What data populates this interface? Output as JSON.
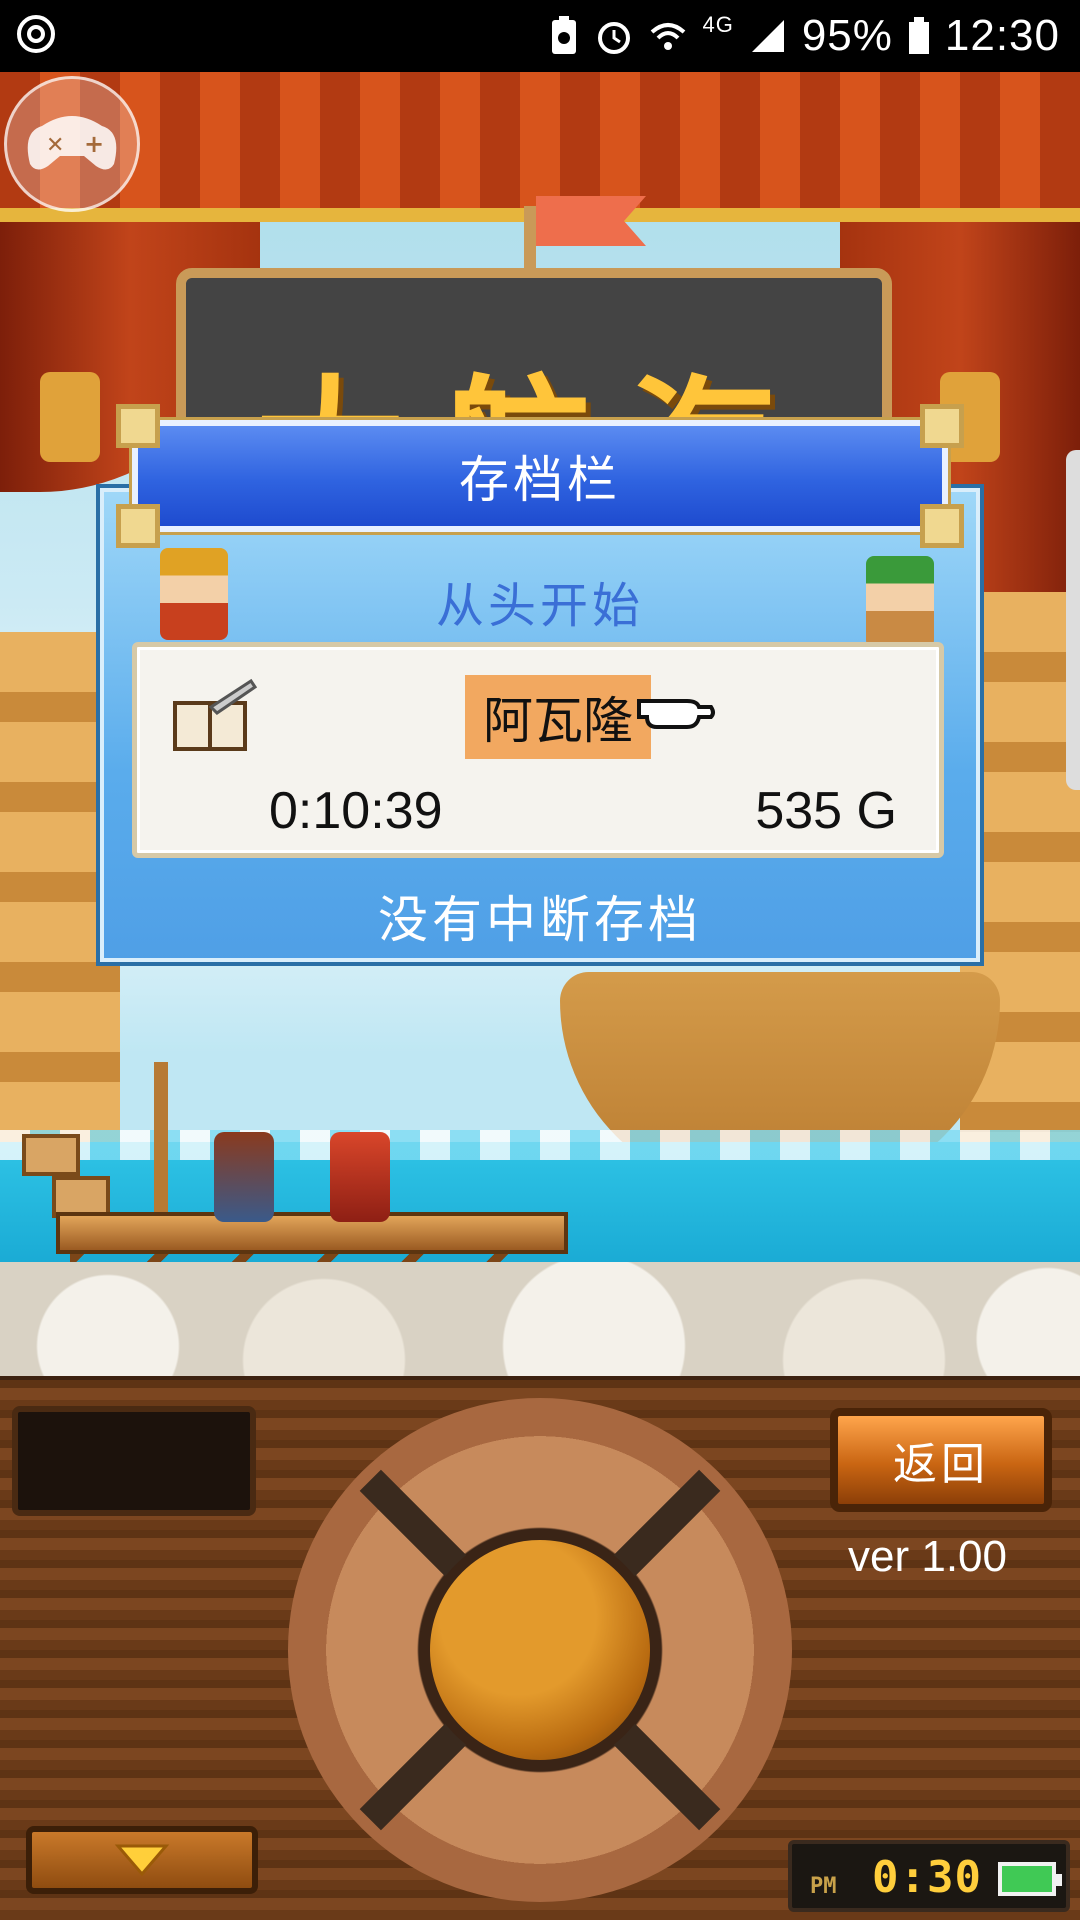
{
  "status_bar": {
    "signal_type": "4G",
    "battery_percent": "95%",
    "time": "12:30",
    "icons": [
      "sync-icon",
      "battery-saver-icon",
      "alarm-icon",
      "wifi-icon",
      "cell-signal-icon",
      "battery-icon"
    ]
  },
  "game": {
    "title": "大航海"
  },
  "save_dialog": {
    "title": "存档栏",
    "start_over_label": "从头开始",
    "slot": {
      "name": "阿瓦隆",
      "play_time": "0:10:39",
      "gold": "535 G"
    },
    "no_suspend_label": "没有中断存档"
  },
  "panel": {
    "back_label": "返回",
    "version": "ver 1.00",
    "clock": {
      "period": "PM",
      "time": "0:30"
    }
  },
  "colors": {
    "dialog_blue": "#4f9fe6",
    "header_blue": "#2f63e0",
    "highlight_orange": "#f2a860",
    "wood_brown": "#6a3a18",
    "clock_yellow": "#ffce3c"
  }
}
